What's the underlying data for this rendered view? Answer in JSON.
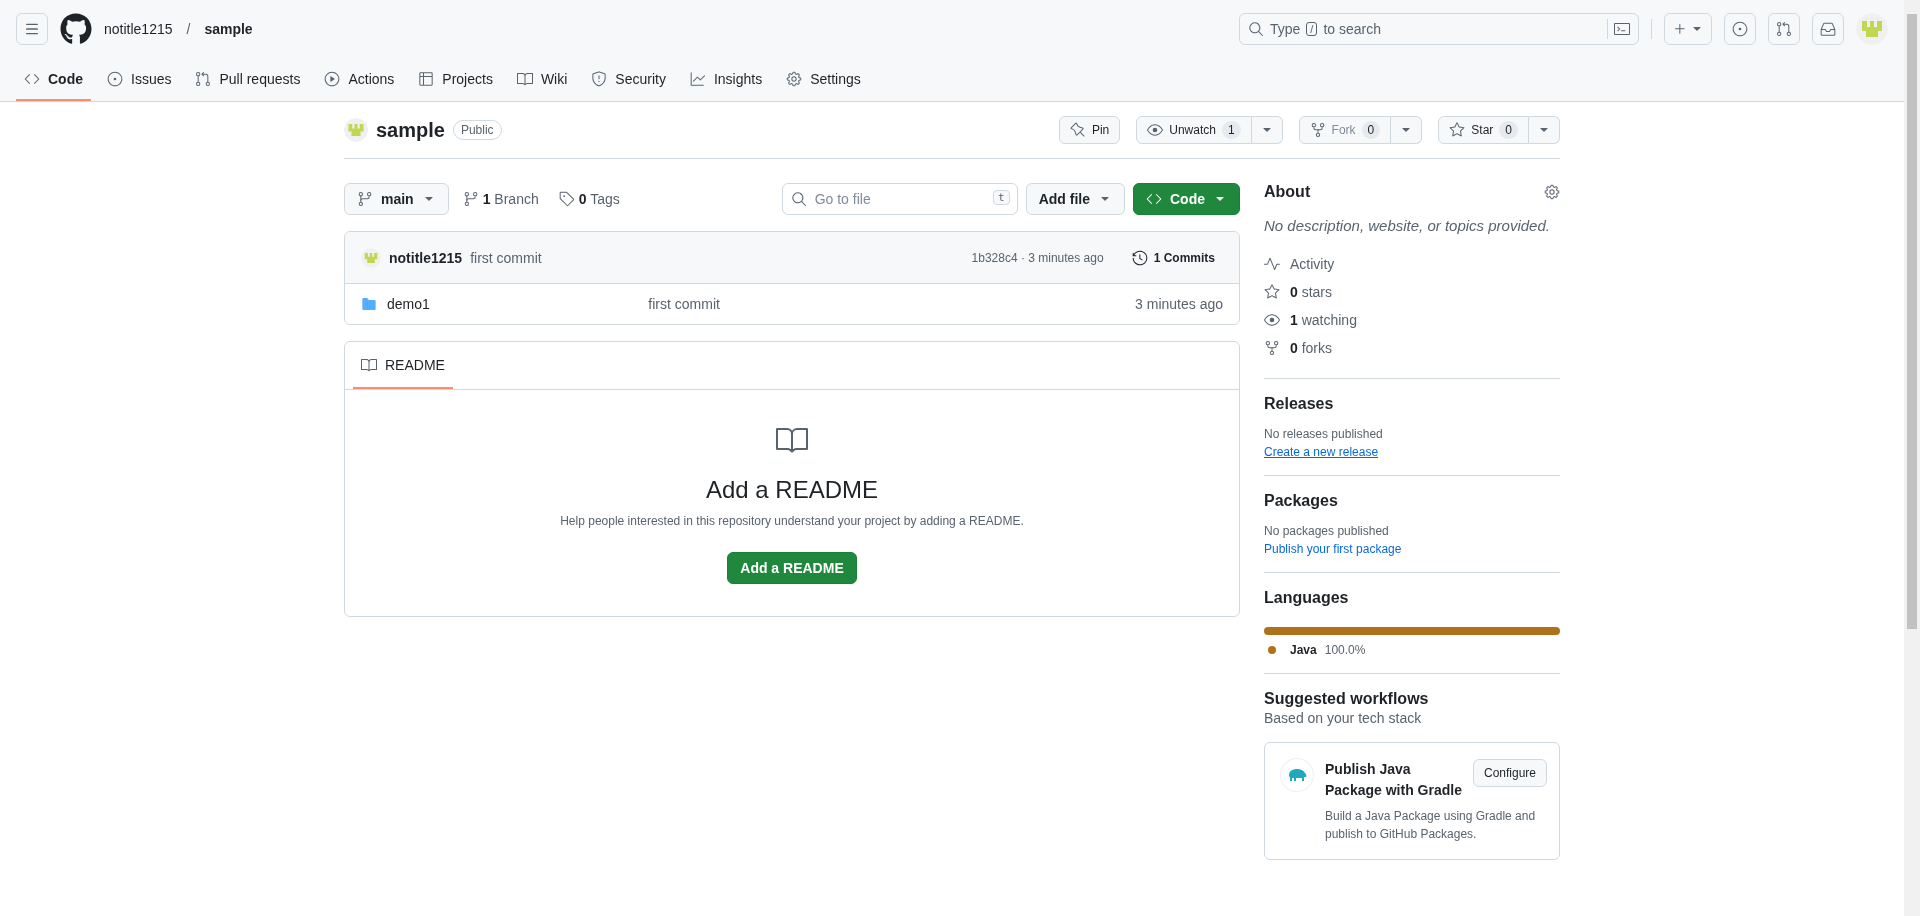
{
  "header": {
    "owner": "notitle1215",
    "separator": "/",
    "repo": "sample",
    "search": {
      "hint_before": "Type",
      "hint_key": "/",
      "hint_after": "to search"
    }
  },
  "tabs": [
    {
      "label": "Code",
      "selected": true
    },
    {
      "label": "Issues",
      "selected": false
    },
    {
      "label": "Pull requests",
      "selected": false
    },
    {
      "label": "Actions",
      "selected": false
    },
    {
      "label": "Projects",
      "selected": false
    },
    {
      "label": "Wiki",
      "selected": false
    },
    {
      "label": "Security",
      "selected": false
    },
    {
      "label": "Insights",
      "selected": false
    },
    {
      "label": "Settings",
      "selected": false
    }
  ],
  "repo": {
    "name": "sample",
    "visibility": "Public",
    "actions": [
      {
        "label": "Pin",
        "disabled": false
      },
      {
        "label": "Unwatch",
        "count": "1",
        "disabled": false
      },
      {
        "label": "Fork",
        "count": "0",
        "disabled": true
      },
      {
        "label": "Star",
        "count": "0",
        "disabled": false
      }
    ]
  },
  "toolbar": {
    "branch": "main",
    "branches": "**1** Branch",
    "tags": "**0** Tags",
    "go_to_file": {
      "placeholder": "Go to file",
      "key": "t"
    },
    "add_file": "Add file",
    "code": "Code"
  },
  "commit": {
    "author": "notitle1215",
    "message": "first commit",
    "info": "1b328c4 · 3 minutes ago",
    "commits": "1 Commits"
  },
  "files": [
    {
      "kind": "folder",
      "name": "demo1",
      "message": "first commit",
      "time": "3 minutes ago"
    }
  ],
  "readme": {
    "tab": "README",
    "title": "Add a README",
    "text": "Help people interested in this repository understand your project by adding a README.",
    "button": "Add a README"
  },
  "sidebar": {
    "about": {
      "title": "About",
      "description": "No description, website, or topics provided.",
      "stats": [
        {
          "label": "Activity"
        },
        {
          "label": "**0** stars"
        },
        {
          "label": "**1** watching"
        },
        {
          "label": "**0** forks"
        }
      ]
    },
    "releases": {
      "title": "Releases",
      "text": "No releases published",
      "link": "Create a new release"
    },
    "packages": {
      "title": "Packages",
      "text": "No packages published",
      "link": "Publish your first package"
    },
    "languages": {
      "title": "Languages",
      "items": [
        {
          "name": "Java",
          "percent": "100.0%",
          "color": "#b07219",
          "level": 1
        }
      ]
    },
    "workflows": {
      "title": "Suggested workflows",
      "subtitle": "Based on your tech stack",
      "cards": [
        {
          "title": "Publish Java Package with Gradle",
          "text": "Build a Java Package using Gradle and publish to GitHub Packages.",
          "button": "Configure"
        }
      ]
    }
  }
}
